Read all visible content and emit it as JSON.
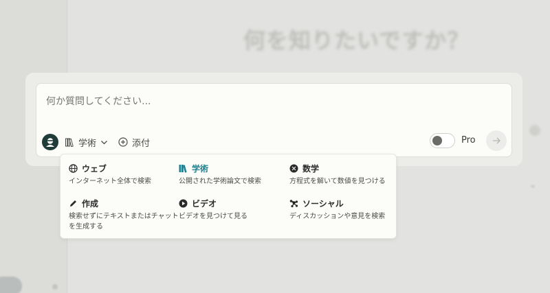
{
  "background": {
    "title": "何を知りたいですか？",
    "sidebar_lines": [
      "",
      "",
      "",
      ""
    ],
    "right_label": "",
    "right_chevron": "⌄"
  },
  "search": {
    "placeholder": "何か質問してください...",
    "value": "",
    "focus_label": "学術",
    "attach_label": "添付",
    "pro_label": "Pro",
    "pro_enabled": false,
    "accent_color": "#20808d"
  },
  "focus_menu": {
    "items": [
      {
        "icon": "globe-icon",
        "title": "ウェブ",
        "desc": "インターネット全体で検索",
        "active": false
      },
      {
        "icon": "books-icon",
        "title": "学術",
        "desc": "公開された学術論文で検索",
        "active": true
      },
      {
        "icon": "math-icon",
        "title": "数学",
        "desc": "方程式を解いて数値を見つける",
        "active": false
      },
      {
        "icon": "pencil-icon",
        "title": "作成",
        "desc": "検索せずにテキストまたはチャットを生成する",
        "active": false
      },
      {
        "icon": "play-icon",
        "title": "ビデオ",
        "desc": "ビデオを見つけて見る",
        "active": false
      },
      {
        "icon": "network-icon",
        "title": "ソーシャル",
        "desc": "ディスカッションや意見を検索",
        "active": false
      }
    ]
  }
}
